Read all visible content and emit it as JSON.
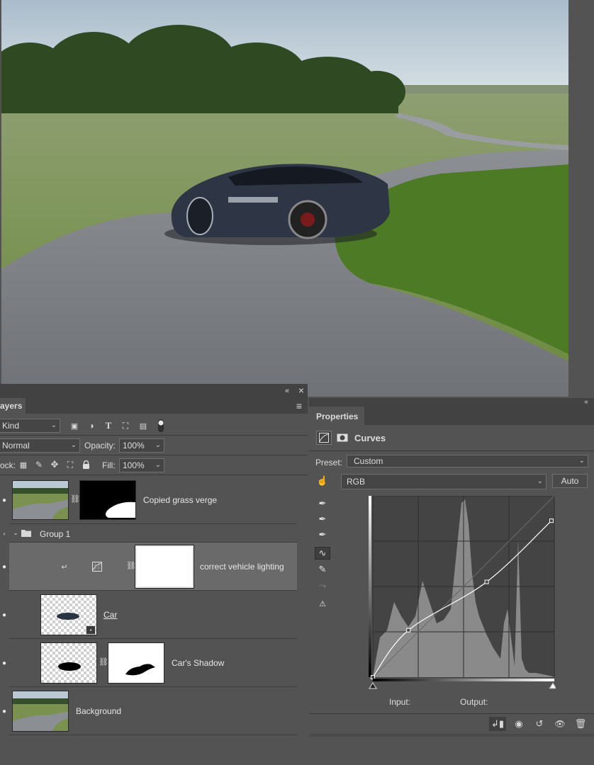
{
  "layers_panel": {
    "tab_label": "ayers",
    "filter_kind": "Kind",
    "blend_mode": "Normal",
    "opacity_label": "Opacity:",
    "opacity_value": "100%",
    "lock_label": "ock:",
    "fill_label": "Fill:",
    "fill_value": "100%",
    "layers": [
      {
        "name": "Copied grass verge",
        "visible": true
      },
      {
        "name": "Group 1",
        "type": "group"
      },
      {
        "name": "correct vehicle lighting",
        "visible": true,
        "selected": true
      },
      {
        "name": "Car",
        "visible": true
      },
      {
        "name": "Car's Shadow",
        "visible": true
      },
      {
        "name": "Background",
        "visible": true
      }
    ]
  },
  "properties_panel": {
    "tab_label": "Properties",
    "adjustment_title": "Curves",
    "preset_label": "Preset:",
    "preset_value": "Custom",
    "channel_value": "RGB",
    "auto_label": "Auto",
    "input_label": "Input:",
    "output_label": "Output:",
    "curve_points": [
      [
        0,
        0
      ],
      [
        50,
        66
      ],
      [
        160,
        134
      ],
      [
        251,
        220
      ]
    ],
    "colors": {
      "panel": "#535353",
      "histogram": "#8a8a8a",
      "graph_bg": "#444444",
      "curve": "#ffffff"
    }
  },
  "icons": {
    "collapse": "«",
    "close": "×",
    "menu": "≡",
    "eye": "👁",
    "chain": "🔗"
  }
}
